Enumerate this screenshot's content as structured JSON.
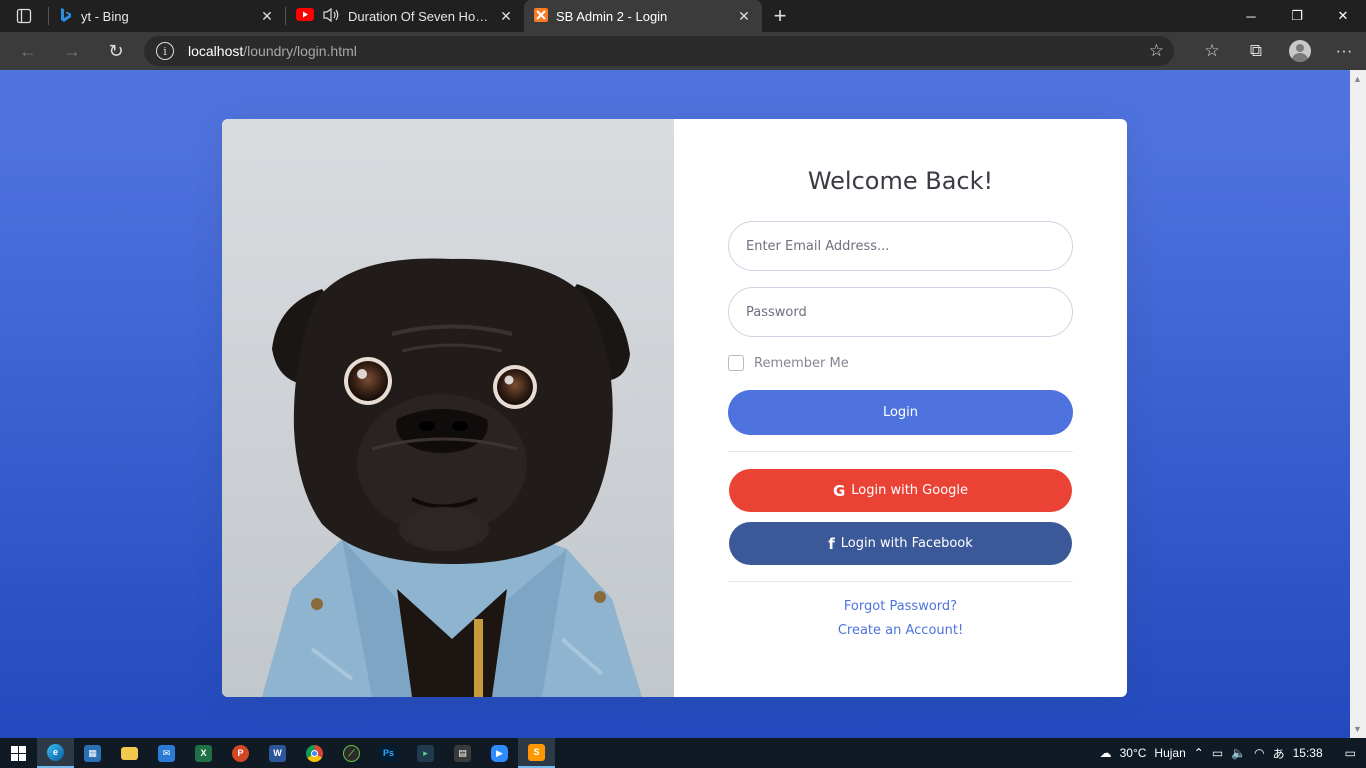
{
  "browser": {
    "tabs": [
      {
        "title": "yt - Bing",
        "favicon": "bing-icon"
      },
      {
        "title": "Duration Of Seven Hours | P",
        "favicon": "youtube-icon",
        "audio": true
      },
      {
        "title": "SB Admin 2 - Login",
        "favicon": "xampp-icon",
        "active": true
      }
    ],
    "url_host": "localhost",
    "url_path": "/loundry/login.html"
  },
  "login": {
    "heading": "Welcome Back!",
    "email_placeholder": "Enter Email Address...",
    "password_placeholder": "Password",
    "remember_label": "Remember Me",
    "login_button": "Login",
    "google_button": "Login with Google",
    "facebook_button": "Login with Facebook",
    "forgot_link": "Forgot Password?",
    "create_link": "Create an Account!"
  },
  "colors": {
    "primary": "#4e73df",
    "google": "#ea4335",
    "facebook": "#3b5998"
  },
  "taskbar": {
    "apps": [
      "windows-start-icon",
      "edge-icon",
      "store-icon",
      "file-explorer-icon",
      "mail-icon",
      "excel-icon",
      "powerpoint-icon",
      "word-icon",
      "chrome-icon",
      "app-icon",
      "photoshop-icon",
      "app-icon-2",
      "calculator-icon",
      "zoom-icon",
      "sublime-icon"
    ],
    "weather_temp": "30°C",
    "weather_text": "Hujan",
    "time": "15:38"
  }
}
